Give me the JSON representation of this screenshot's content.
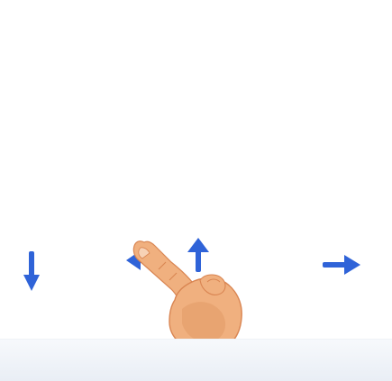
{
  "gesture_demo": {
    "icons": {
      "down": "arrow-down-icon",
      "left": "arrow-left-icon",
      "up": "arrow-up-icon",
      "right": "arrow-right-icon",
      "hand": "hand-swipe-icon"
    },
    "colors": {
      "arrow": "#2f63d8",
      "arrow_dark": "#1e4fb9",
      "skin": "#f0b07f",
      "skin_shadow": "#e29a66",
      "nail": "#f7d2b6",
      "outline": "#d98552"
    }
  }
}
